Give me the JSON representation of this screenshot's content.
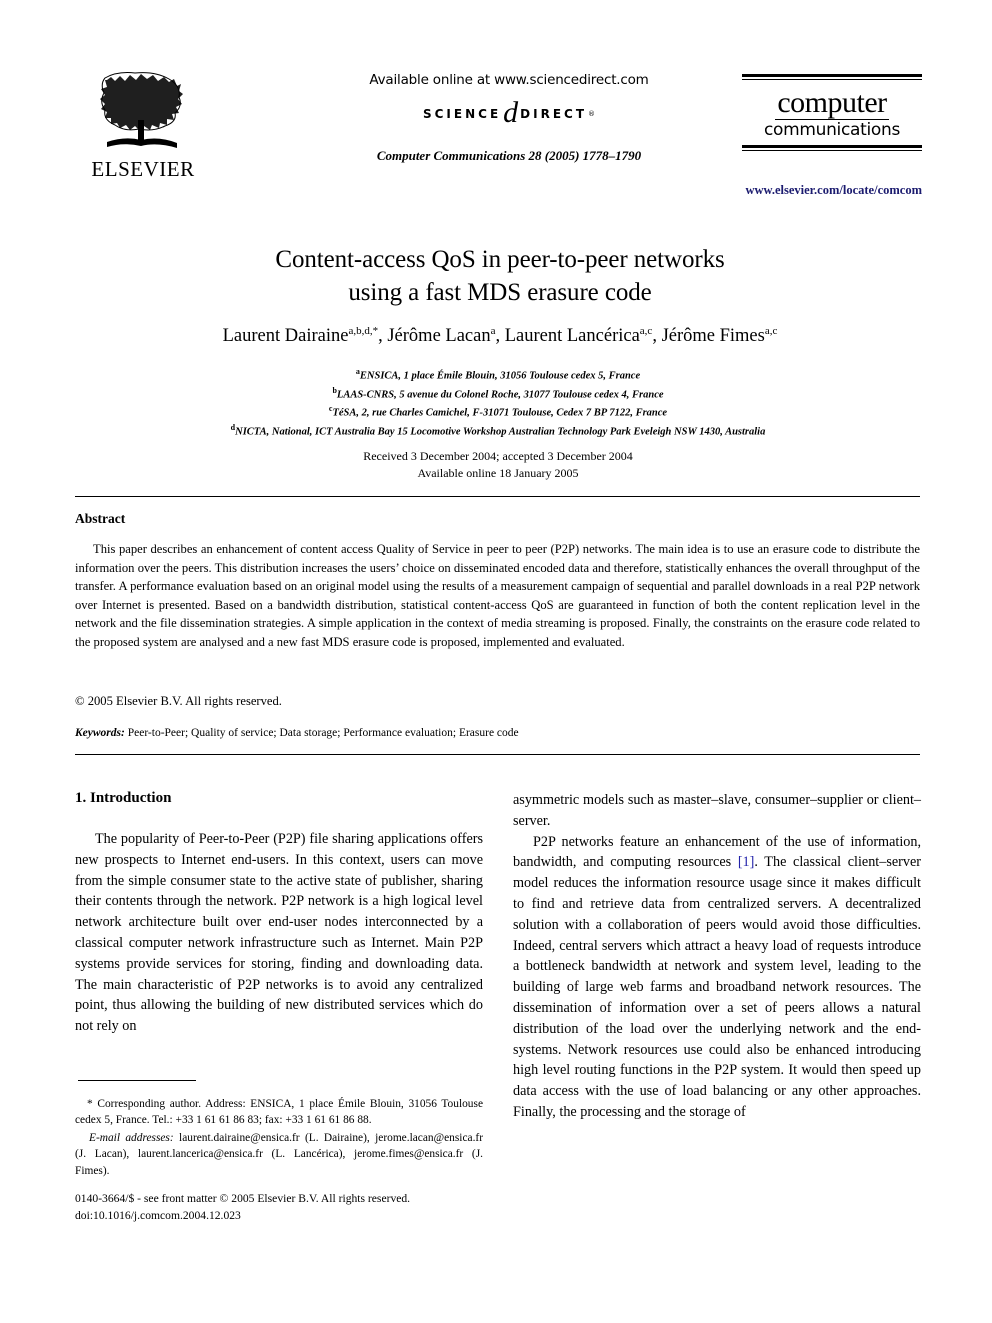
{
  "header": {
    "publisher_name": "ELSEVIER",
    "publisher_logo_icon": "elsevier-tree-logo",
    "available_online": "Available online at www.sciencedirect.com",
    "sciencedirect_science": "SCIENCE",
    "sciencedirect_at": "d",
    "sciencedirect_direct": "DIRECT",
    "sciencedirect_tm": "®",
    "journal_reference": "Computer Communications 28 (2005) 1778–1790",
    "journal_logo_line1": "computer",
    "journal_logo_line2": "communications",
    "journal_url": "www.elsevier.com/locate/comcom"
  },
  "article": {
    "title_line1": "Content-access QoS in peer-to-peer networks",
    "title_line2": "using a fast MDS erasure code",
    "authors": [
      {
        "name": "Laurent Dairaine",
        "sup": "a,b,d,*",
        "sep": ", "
      },
      {
        "name": "Jérôme Lacan",
        "sup": "a",
        "sep": ", "
      },
      {
        "name": "Laurent Lancérica",
        "sup": "a,c",
        "sep": ", "
      },
      {
        "name": "Jérôme Fimes",
        "sup": "a,c",
        "sep": ""
      }
    ],
    "affiliations": [
      {
        "sup": "a",
        "text": "ENSICA, 1 place Émile Blouin, 31056 Toulouse cedex 5, France"
      },
      {
        "sup": "b",
        "text": "LAAS-CNRS, 5 avenue du Colonel Roche, 31077 Toulouse cedex 4, France"
      },
      {
        "sup": "c",
        "text": "TéSA, 2, rue Charles Camichel, F-31071 Toulouse, Cedex 7 BP 7122, France"
      },
      {
        "sup": "d",
        "text": "NICTA, National, ICT Australia Bay 15 Locomotive Workshop Australian Technology Park Eveleigh NSW 1430, Australia"
      }
    ],
    "date_received": "Received 3 December 2004; accepted 3 December 2004",
    "date_available": "Available online 18 January 2005"
  },
  "abstract": {
    "heading": "Abstract",
    "text": "This paper describes an enhancement of content access Quality of Service in peer to peer (P2P) networks. The main idea is to use an erasure code to distribute the information over the peers. This distribution increases the users’ choice on disseminated encoded data and therefore, statistically enhances the overall throughput of the transfer. A performance evaluation based on an original model using the results of a measurement campaign of sequential and parallel downloads in a real P2P network over Internet is presented. Based on a bandwidth distribution, statistical content-access QoS are guaranteed in function of both the content replication level in the network and the file dissemination strategies. A simple application in the context of media streaming is proposed. Finally, the constraints on the erasure code related to the proposed system are analysed and a new fast MDS erasure code is proposed, implemented and evaluated.",
    "copyright": "© 2005 Elsevier B.V. All rights reserved.",
    "keywords_label": "Keywords:",
    "keywords_text": "Peer-to-Peer; Quality of service; Data storage; Performance evaluation; Erasure code"
  },
  "body": {
    "section_heading": "1. Introduction",
    "left_paragraph_1": "The popularity of Peer-to-Peer (P2P) file sharing applications offers new prospects to Internet end-users. In this context, users can move from the simple consumer state to the active state of publisher, sharing their contents through the network. P2P network is a high logical level network architecture built over end-user nodes interconnected by a classical computer network infrastructure such as Internet. Main P2P systems provide services for storing, finding and downloading data. The main characteristic of P2P networks is to avoid any centralized point, thus allowing the building of new distributed services which do not rely on",
    "right_paragraph_1_continued": "asymmetric models such as master–slave, consumer–supplier or client–server.",
    "right_paragraph_2_part1": "P2P networks feature an enhancement of the use of information, bandwidth, and computing resources ",
    "right_paragraph_2_citation": "[1]",
    "right_paragraph_2_part2": ". The classical client–server model reduces the information resource usage since it makes difficult to find and retrieve data from centralized servers. A decentralized solution with a collaboration of peers would avoid those difficulties. Indeed, central servers which attract a heavy load of requests introduce a bottleneck bandwidth at network and system level, leading to the building of large web farms and broadband network resources. The dissemination of information over a set of peers allows a natural distribution of the load over the underlying network and the end-systems. Network resources use could also be enhanced introducing high level routing functions in the P2P system. It would then speed up data access with the use of load balancing or any other approaches. Finally, the processing and the storage of"
  },
  "footnotes": {
    "corresponding_author": "* Corresponding author. Address: ENSICA, 1 place Émile Blouin, 31056 Toulouse cedex 5, France. Tel.: +33 1 61 61 86 83; fax: +33 1 61 61 86 88.",
    "email_label": "E-mail addresses:",
    "email_text": "laurent.dairaine@ensica.fr (L. Dairaine), jerome.lacan@ensica.fr (J. Lacan), laurent.lancerica@ensica.fr (L. Lancérica), jerome.fimes@ensica.fr (J. Fimes)."
  },
  "footer": {
    "issn_line": "0140-3664/$ - see front matter © 2005 Elsevier B.V. All rights reserved.",
    "doi_line": "doi:10.1016/j.comcom.2004.12.023"
  },
  "colors": {
    "text": "#000000",
    "link_navy": "#1b1b6f",
    "citation_blue": "#2222aa",
    "background": "#ffffff"
  }
}
